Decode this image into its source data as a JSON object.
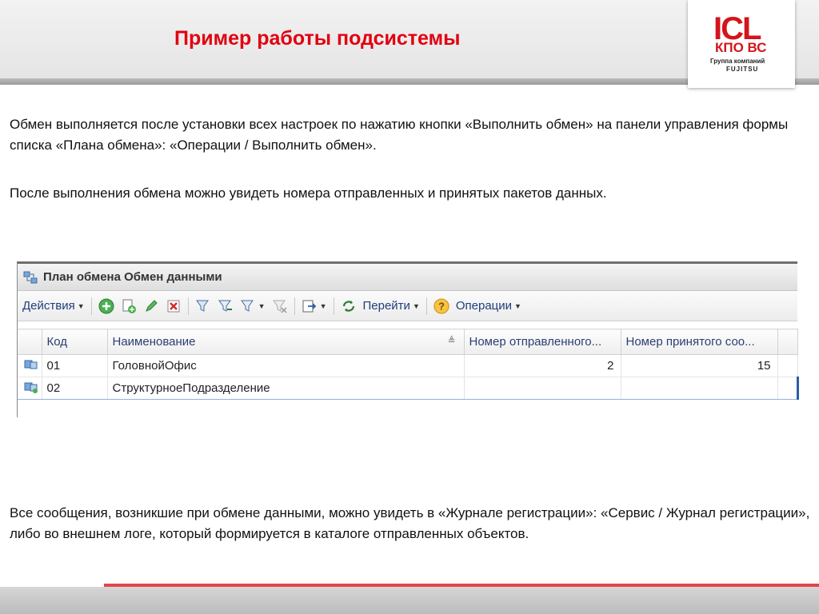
{
  "slide": {
    "title": "Пример работы подсистемы",
    "logo": {
      "brand": "ICL",
      "sub": "КПО ВС",
      "group": "Группа компаний",
      "partner": "FUJITSU"
    },
    "paragraph1": "Обмен выполняется после установки всех настроек по нажатию кнопки «Выполнить обмен» на панели управления формы списка «Плана обмена»: «Операции / Выполнить обмен».",
    "paragraph2": "После выполнения обмена можно увидеть номера отправленных и принятых пакетов данных.",
    "paragraph3": "Все сообщения, возникшие при обмене данными,  можно увидеть  в «Журнале регистрации»: «Сервис / Журнал регистрации»,  либо во внешнем логе, который формируется в каталоге отправленных объектов."
  },
  "window": {
    "title": "План обмена Обмен данными",
    "toolbar": {
      "actions_label": "Действия",
      "goto_label": "Перейти",
      "operations_label": "Операции"
    },
    "columns": {
      "code": "Код",
      "name": "Наименование",
      "sent": "Номер отправленного...",
      "received": "Номер принятого соо..."
    },
    "rows": [
      {
        "code": "01",
        "name": "ГоловнойОфис",
        "sent": "2",
        "received": "15"
      },
      {
        "code": "02",
        "name": "СтруктурноеПодразделение",
        "sent": "",
        "received": ""
      }
    ]
  },
  "colors": {
    "title": "#e2000f",
    "logo": "#d4141c",
    "footer_accent": "#e3444c"
  }
}
